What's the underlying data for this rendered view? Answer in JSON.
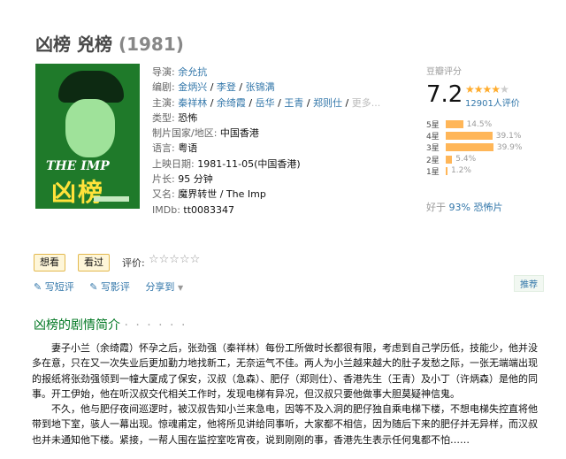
{
  "movie": {
    "title": "凶榜 兇榜",
    "year": "(1981)"
  },
  "poster": {
    "logo_en": "THE IMP",
    "logo_cn": "凶榜"
  },
  "info": {
    "director_label": "导演:",
    "director": "余允抗",
    "writer_label": "编剧:",
    "writers": [
      "金炳兴",
      "李登",
      "张锦满"
    ],
    "cast_label": "主演:",
    "cast": [
      "秦祥林",
      "余绮霞",
      "岳华",
      "王青",
      "郑则仕"
    ],
    "cast_more": "更多...",
    "genre_label": "类型:",
    "genre": "恐怖",
    "country_label": "制片国家/地区:",
    "country": "中国香港",
    "language_label": "语言:",
    "language": "粤语",
    "release_label": "上映日期:",
    "release": "1981-11-05(中国香港)",
    "runtime_label": "片长:",
    "runtime": "95 分钟",
    "aka_label": "又名:",
    "aka": "魔界转世 / The Imp",
    "imdb_label": "IMDb:",
    "imdb": "tt0083347"
  },
  "rating": {
    "header": "豆瓣评分",
    "score": "7.2",
    "stars_on": 3.5,
    "count": "12901人评价",
    "distribution": [
      {
        "label": "5星",
        "percent": "14.5%",
        "value": 14.5
      },
      {
        "label": "4星",
        "percent": "39.1%",
        "value": 39.1
      },
      {
        "label": "3星",
        "percent": "39.9%",
        "value": 39.9
      },
      {
        "label": "2星",
        "percent": "5.4%",
        "value": 5.4
      },
      {
        "label": "1星",
        "percent": "1.2%",
        "value": 1.2
      }
    ],
    "better_prefix": "好于 ",
    "better_value": "93% 恐怖片"
  },
  "actions": {
    "want": "想看",
    "seen": "看过",
    "rate_label": "评价:",
    "rate_stars": "☆☆☆☆☆",
    "short_review": "写短评",
    "review": "写影评",
    "share": "分享到",
    "recommend": "推荐"
  },
  "summary": {
    "title": "凶榜的剧情简介",
    "dots": "· · · · · ·",
    "paragraphs": [
      "妻子小兰（余绮霞）怀孕之后，张劲强（秦祥林）每份工所做时长都很有限，考虑到自己学历低，技能少，他并没多在意，只在又一次失业后更加勤力地找新工，无奈运气不佳。两人为小兰越来越大的肚子发愁之际，一张无端端出现的报纸将张劲强领到一幢大厦成了保安，汉叔（急森）、肥仔（郑则仕）、香港先生（王青）及小丁（许炳森）是他的同事。开工伊始，他在听汉叔交代相关工作时，发现电梯有异况，但汉叔只要他做事大胆莫疑神信鬼。",
      "不久，他与肥仔夜间巡逻时，被汉叔告知小兰来急电，因等不及入洞的肥仔独自乘电梯下楼，不想电梯失控直将他带到地下室，骇人一幕出现。惊魂甫定，他将所见讲给同事听，大家都不相信，因为随后下来的肥仔并无异样，而汉叔也并未通知他下楼。紧接，一帮人围在监控室吃宵夜，说到刚刚的事，香港先生表示任何鬼都不怕……"
    ]
  }
}
